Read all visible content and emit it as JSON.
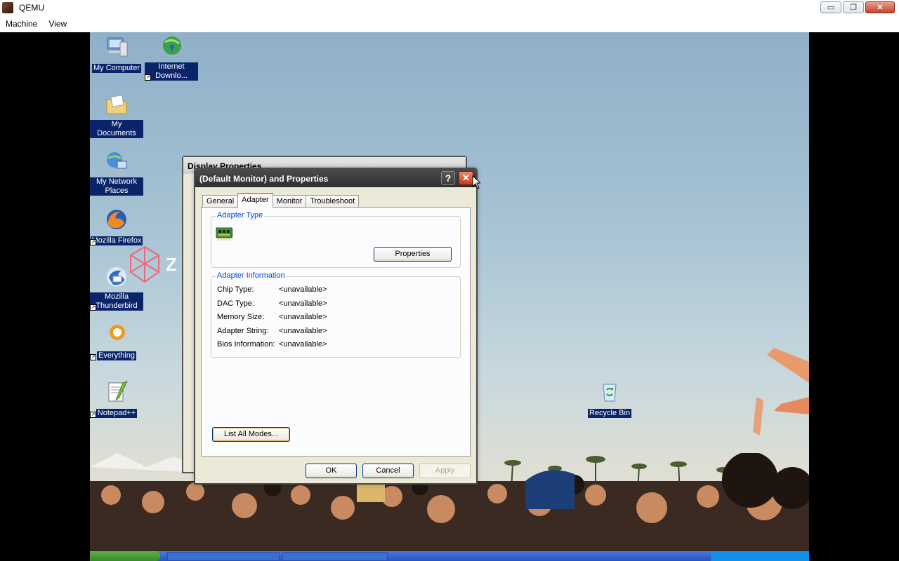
{
  "host": {
    "title": "QEMU",
    "menu": [
      "Machine",
      "View"
    ],
    "controls": {
      "minimize": "▭",
      "restore": "❐",
      "close": "✕"
    }
  },
  "desktop_icons": [
    {
      "label": "My Computer",
      "icon": "computer-icon",
      "shortcut": false
    },
    {
      "label": "Internet Downlo...",
      "icon": "idm-icon",
      "shortcut": true
    },
    {
      "label": "My Documents",
      "icon": "documents-folder-icon",
      "shortcut": false
    },
    {
      "label": "My Network Places",
      "icon": "network-places-icon",
      "shortcut": false
    },
    {
      "label": "Mozilla Firefox",
      "icon": "firefox-icon",
      "shortcut": true
    },
    {
      "label": "Mozilla Thunderbird",
      "icon": "thunderbird-icon",
      "shortcut": true
    },
    {
      "label": "Everything",
      "icon": "everything-icon",
      "shortcut": true
    },
    {
      "label": "Notepad++",
      "icon": "notepadpp-icon",
      "shortcut": true
    },
    {
      "label": "Recycle Bin",
      "icon": "recycle-bin-icon",
      "shortcut": false
    }
  ],
  "back_dialog": {
    "title": "Display Properties",
    "help": "?",
    "close": "✕"
  },
  "dialog": {
    "title": "(Default Monitor) and  Properties",
    "help": "?",
    "close": "✕",
    "tabs": [
      {
        "label": "General",
        "active": false
      },
      {
        "label": "Adapter",
        "active": true
      },
      {
        "label": "Monitor",
        "active": false
      },
      {
        "label": "Troubleshoot",
        "active": false
      }
    ],
    "adapter_type": {
      "title": "Adapter Type",
      "properties_button": "Properties"
    },
    "adapter_info": {
      "title": "Adapter Information",
      "rows": [
        {
          "key": "Chip Type:",
          "value": "<unavailable>"
        },
        {
          "key": "DAC Type:",
          "value": "<unavailable>"
        },
        {
          "key": "Memory Size:",
          "value": "<unavailable>"
        },
        {
          "key": "Adapter String:",
          "value": "<unavailable>"
        },
        {
          "key": "Bios Information:",
          "value": "<unavailable>"
        }
      ]
    },
    "list_modes_button": "List All Modes...",
    "ok_button": "OK",
    "cancel_button": "Cancel",
    "apply_button": "Apply"
  },
  "colors": {
    "selection_label": "#0a246a",
    "group_title": "#0046d5",
    "tab_active_border": "#e68b2c",
    "close_button": "#c4391c"
  }
}
